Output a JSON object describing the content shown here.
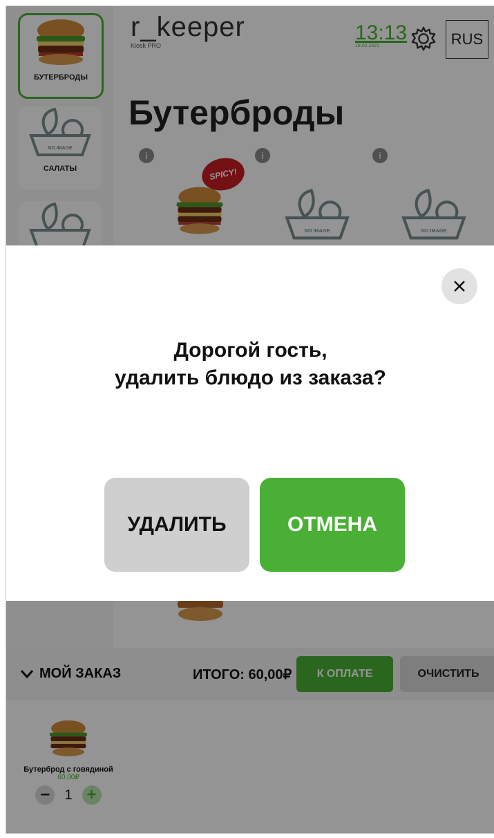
{
  "app": {
    "brand": "r_keeper",
    "brand_sub": "Kiosk PRO",
    "time": "13:13",
    "date": "18.02.2021",
    "language": "RUS",
    "page_title": "Бутерброды",
    "spicy_label": "SPICY!",
    "info_label": "i",
    "no_image_label": "NO IMAGE"
  },
  "sidebar": {
    "items": [
      {
        "label": "БУТЕРБРОДЫ",
        "active": true
      },
      {
        "label": "САЛАТЫ",
        "active": false
      }
    ]
  },
  "order": {
    "toggle_label": "МОЙ ЗАКАЗ",
    "total_label": "ИТОГО: 60,00₽",
    "pay_label": "К ОПЛАТЕ",
    "clear_label": "ОЧИСТИТЬ",
    "items": [
      {
        "name": "Бутерброд с говядиной",
        "price": "60,00₽",
        "qty": "1"
      }
    ],
    "minus": "−",
    "plus": "+"
  },
  "modal": {
    "question_line1": "Дорогой гость,",
    "question_line2": "удалить блюдо из заказа?",
    "delete_label": "УДАЛИТЬ",
    "cancel_label": "ОТМЕНА",
    "close_icon": "×"
  },
  "colors": {
    "accent": "#49b035",
    "spicy": "#c81e25",
    "delete_bg": "#cfcfcf"
  }
}
